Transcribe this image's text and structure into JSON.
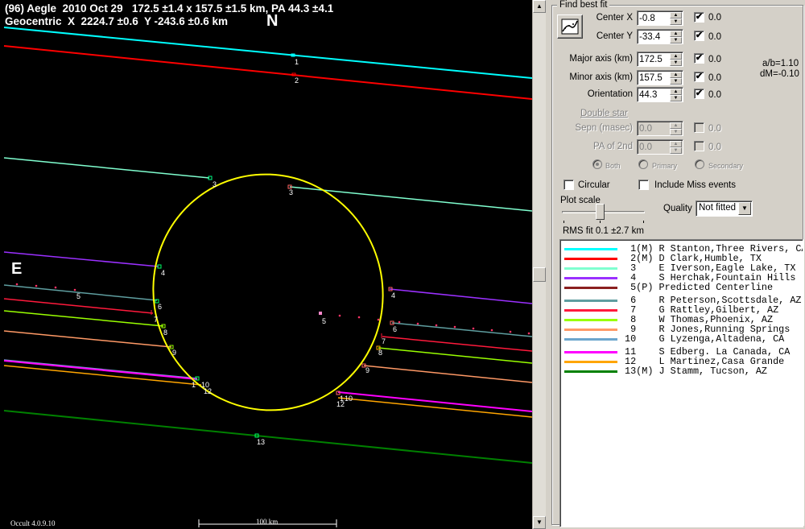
{
  "header": {
    "line1": "(96) Aegle  2010 Oct 29   172.5 ±1.4 x 157.5 ±1.5 km, PA 44.3 ±4.1",
    "line2": "Geocentric  X  2224.7 ±0.6  Y -243.6 ±0.6 km"
  },
  "compass": {
    "north": "N",
    "east": "E"
  },
  "footer": {
    "version": "Occult 4.0.9.10",
    "scale": "100 km"
  },
  "colors": {
    "c1": "#00ffff",
    "c2": "#ff0000",
    "c3": "#80ffd0",
    "c4": "#9b30ff",
    "c5": "#8b2020",
    "c6": "#5f9ea0",
    "c7": "#ff1a3c",
    "c8": "#99ff00",
    "c9": "#ff9966",
    "c10": "#6ca6cd",
    "c11": "#ff00ff",
    "c12": "#ffa500",
    "c13": "#008000",
    "ellipse": "#ffff00"
  },
  "chords": [
    {
      "n": "1",
      "start": "1",
      "end": "1"
    },
    {
      "n": "2",
      "start": "2",
      "end": "2"
    },
    {
      "n": "3",
      "start": "3",
      "end": "3"
    },
    {
      "n": "4",
      "start": "4",
      "end": "4"
    },
    {
      "n": "5",
      "start": "5",
      "end": "5"
    },
    {
      "n": "6",
      "start": "6",
      "end": "6"
    },
    {
      "n": "7",
      "start": "7",
      "end": "7"
    },
    {
      "n": "8",
      "start": "8",
      "end": "8"
    },
    {
      "n": "9",
      "start": "9",
      "end": "9"
    },
    {
      "n": "10",
      "start": "10",
      "end": "10"
    },
    {
      "n": "11",
      "start": "1",
      "end": "1"
    },
    {
      "n": "12",
      "start": "12",
      "end": "12"
    },
    {
      "n": "13",
      "start": "13",
      "end": "13"
    }
  ],
  "panel": {
    "group_title": "Find best fit",
    "fit_button_icon": "fit-curve-icon",
    "center_x": {
      "label": "Center X",
      "value": "-0.8",
      "checked": "✔",
      "result": "0.0"
    },
    "center_y": {
      "label": "Center Y",
      "value": "-33.4",
      "checked": "✔",
      "result": "0.0"
    },
    "major": {
      "label": "Major axis (km)",
      "value": "172.5",
      "checked": "✔",
      "result": "0.0"
    },
    "minor": {
      "label": "Minor axis (km)",
      "value": "157.5",
      "checked": "✔",
      "result": "0.0"
    },
    "orient": {
      "label": "Orientation",
      "value": "44.3",
      "checked": "✔",
      "result": "0.0"
    },
    "ratio_ab": "a/b=1.10",
    "ratio_dm": "dM=-0.10",
    "double_star": "Double star",
    "sepn": {
      "label": "Sepn (masec)",
      "value": "0.0",
      "result": "0.0"
    },
    "pa2": {
      "label": "PA of 2nd",
      "value": "0.0",
      "result": "0.0"
    },
    "radio_both": "Both",
    "radio_primary": "Primary",
    "radio_secondary": "Secondary",
    "circular": "Circular",
    "include_miss": "Include Miss events",
    "plot_scale": "Plot scale",
    "quality_label": "Quality",
    "quality_value": "Not fitted",
    "rms": "RMS fit 0.1 ±2.7 km"
  },
  "legend": [
    {
      "num": " 1(M)",
      "text": "R Stanton,Three Rivers, CA",
      "color": "#00ffff"
    },
    {
      "num": " 2(M)",
      "text": "D Clark,Humble, TX",
      "color": "#ff0000"
    },
    {
      "num": " 3   ",
      "text": "E Iverson,Eagle Lake, TX",
      "color": "#80ffd0"
    },
    {
      "num": " 4   ",
      "text": "S Herchak,Fountain Hills",
      "color": "#9b30ff"
    },
    {
      "num": " 5(P)",
      "text": "Predicted Centerline",
      "color": "#8b2020"
    },
    {
      "num": " 6   ",
      "text": "R Peterson,Scottsdale, AZ",
      "color": "#5f9ea0"
    },
    {
      "num": " 7   ",
      "text": "G Rattley,Gilbert, AZ",
      "color": "#ff1a3c"
    },
    {
      "num": " 8   ",
      "text": "W Thomas,Phoenix, AZ",
      "color": "#99ff00"
    },
    {
      "num": " 9   ",
      "text": "R Jones,Running Springs",
      "color": "#ff9966"
    },
    {
      "num": "10   ",
      "text": "G Lyzenga,Altadena, CA",
      "color": "#6ca6cd"
    },
    {
      "num": "11   ",
      "text": "S Edberg. La Canada, CA",
      "color": "#ff00ff"
    },
    {
      "num": "12   ",
      "text": "L Martinez,Casa Grande",
      "color": "#ffa500"
    },
    {
      "num": "13(M)",
      "text": "J Stamm, Tucson, AZ",
      "color": "#008000"
    }
  ]
}
